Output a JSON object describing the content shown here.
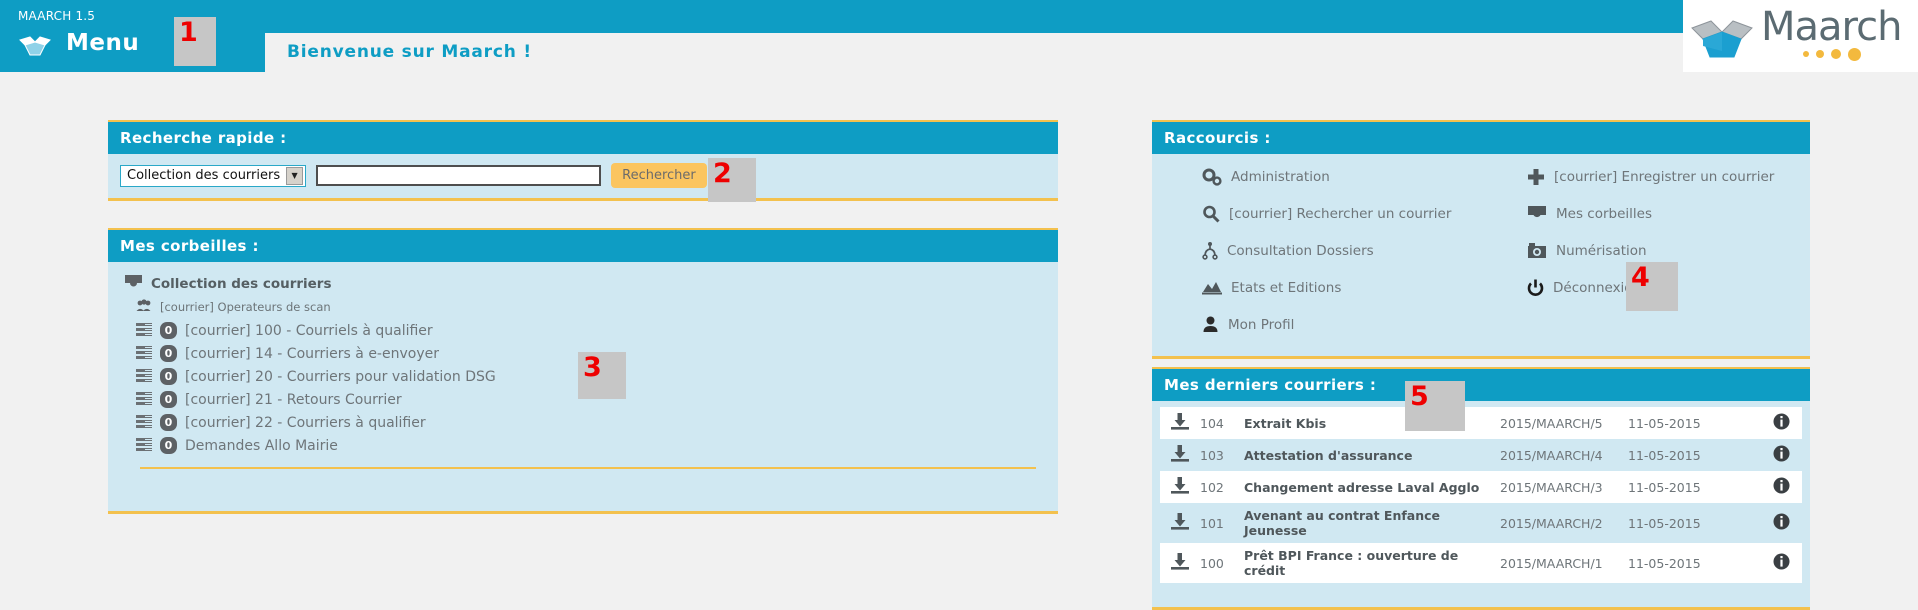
{
  "topbar": {
    "version": "MAARCH 1.5",
    "menu_label": "Menu",
    "welcome": "Bienvenue sur Maarch !",
    "logo_text": "Maarch",
    "logo_icon": "open-box-icon"
  },
  "search_panel": {
    "title": "Recherche rapide :",
    "collection_selected": "Collection des courriers",
    "query_value": "",
    "query_placeholder": "",
    "submit_label": "Rechercher"
  },
  "baskets_panel": {
    "title": "Mes corbeilles :",
    "collection": {
      "label": "Collection des courriers",
      "icon": "inbox-icon"
    },
    "group": {
      "label": "[courrier] Operateurs de scan",
      "icon": "users-icon"
    },
    "items": [
      {
        "count": "0",
        "label": "[courrier] 100 - Courriels à qualifier"
      },
      {
        "count": "0",
        "label": "[courrier] 14 - Courriers à e-envoyer"
      },
      {
        "count": "0",
        "label": "[courrier] 20 - Courriers pour validation DSG"
      },
      {
        "count": "0",
        "label": "[courrier] 21 - Retours Courrier"
      },
      {
        "count": "0",
        "label": "[courrier] 22 - Courriers à qualifier"
      },
      {
        "count": "0",
        "label": "Demandes Allo Mairie"
      }
    ]
  },
  "shortcuts_panel": {
    "title": "Raccourcis :",
    "items": [
      {
        "label": "Administration",
        "icon": "gears-icon"
      },
      {
        "label": "[courrier] Enregistrer un courrier",
        "icon": "plus-icon"
      },
      {
        "label": "[courrier] Rechercher un courrier",
        "icon": "search-icon"
      },
      {
        "label": "Mes corbeilles",
        "icon": "inbox-icon"
      },
      {
        "label": "Consultation Dossiers",
        "icon": "sitemap-icon"
      },
      {
        "label": "Numérisation",
        "icon": "camera-icon"
      },
      {
        "label": "Etats et Editions",
        "icon": "chart-area-icon"
      },
      {
        "label": "Déconnexion",
        "icon": "power-icon"
      },
      {
        "label": "Mon Profil",
        "icon": "user-icon"
      }
    ]
  },
  "mails_panel": {
    "title": "Mes derniers courriers :",
    "rows": [
      {
        "id": "104",
        "title": "Extrait Kbis",
        "reference": "2015/MAARCH/5",
        "date": "11-05-2015",
        "download_icon": "download-icon",
        "info_icon": "info-icon"
      },
      {
        "id": "103",
        "title": "Attestation d'assurance",
        "reference": "2015/MAARCH/4",
        "date": "11-05-2015",
        "download_icon": "download-icon",
        "info_icon": "info-icon"
      },
      {
        "id": "102",
        "title": "Changement adresse Laval Agglo",
        "reference": "2015/MAARCH/3",
        "date": "11-05-2015",
        "download_icon": "download-icon",
        "info_icon": "info-icon"
      },
      {
        "id": "101",
        "title": "Avenant au contrat Enfance Jeunesse",
        "reference": "2015/MAARCH/2",
        "date": "11-05-2015",
        "download_icon": "download-icon",
        "info_icon": "info-icon"
      },
      {
        "id": "100",
        "title": "Prêt BPI France : ouverture de crédit",
        "reference": "2015/MAARCH/1",
        "date": "11-05-2015",
        "download_icon": "download-icon",
        "info_icon": "info-icon"
      }
    ]
  },
  "markers": {
    "m1": "1",
    "m2": "2",
    "m3": "3",
    "m4": "4",
    "m5": "5"
  },
  "colors": {
    "teal": "#0e9dc4",
    "panel_bg": "#d0e8f2",
    "gold": "#f3c14e",
    "button": "#fbc55f",
    "text_gray": "#6e7579",
    "marker_red": "#ee0000"
  }
}
